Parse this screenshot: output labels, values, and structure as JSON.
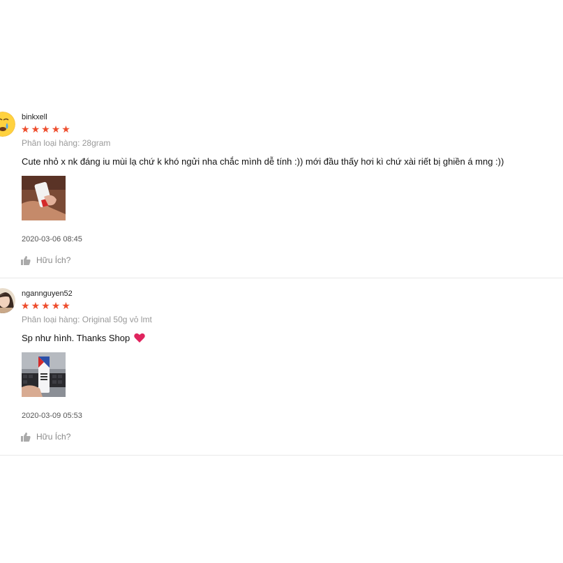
{
  "reviews": [
    {
      "username": "binkxell",
      "rating": 5,
      "variant": "Phân loại hàng: 28gram",
      "comment": "Cute nhỏ x nk đáng iu mùi lạ chứ k khó ngửi nha chắc mình dễ tính :)) mới đầu thấy hơi kì chứ xài riết bị ghiền á mng :))",
      "timestamp": "2020-03-06 08:45",
      "helpful_label": "Hữu Ích?",
      "avatar_icon": "crying-emoji-icon",
      "photo_icon": "product-photo"
    },
    {
      "username": "ngannguyen52",
      "rating": 5,
      "variant": "Phân loại hàng: Original 50g vỏ lmt",
      "comment": "Sp như hình. Thanks Shop",
      "comment_emoji": "heart-icon",
      "timestamp": "2020-03-09 05:53",
      "helpful_label": "Hữu Ích?",
      "avatar_icon": "user-photo-avatar",
      "photo_icon": "product-photo"
    }
  ],
  "colors": {
    "star": "#ee4d2d",
    "muted": "#999999",
    "divider": "#e8e8e8",
    "heart": "#e0245e"
  }
}
